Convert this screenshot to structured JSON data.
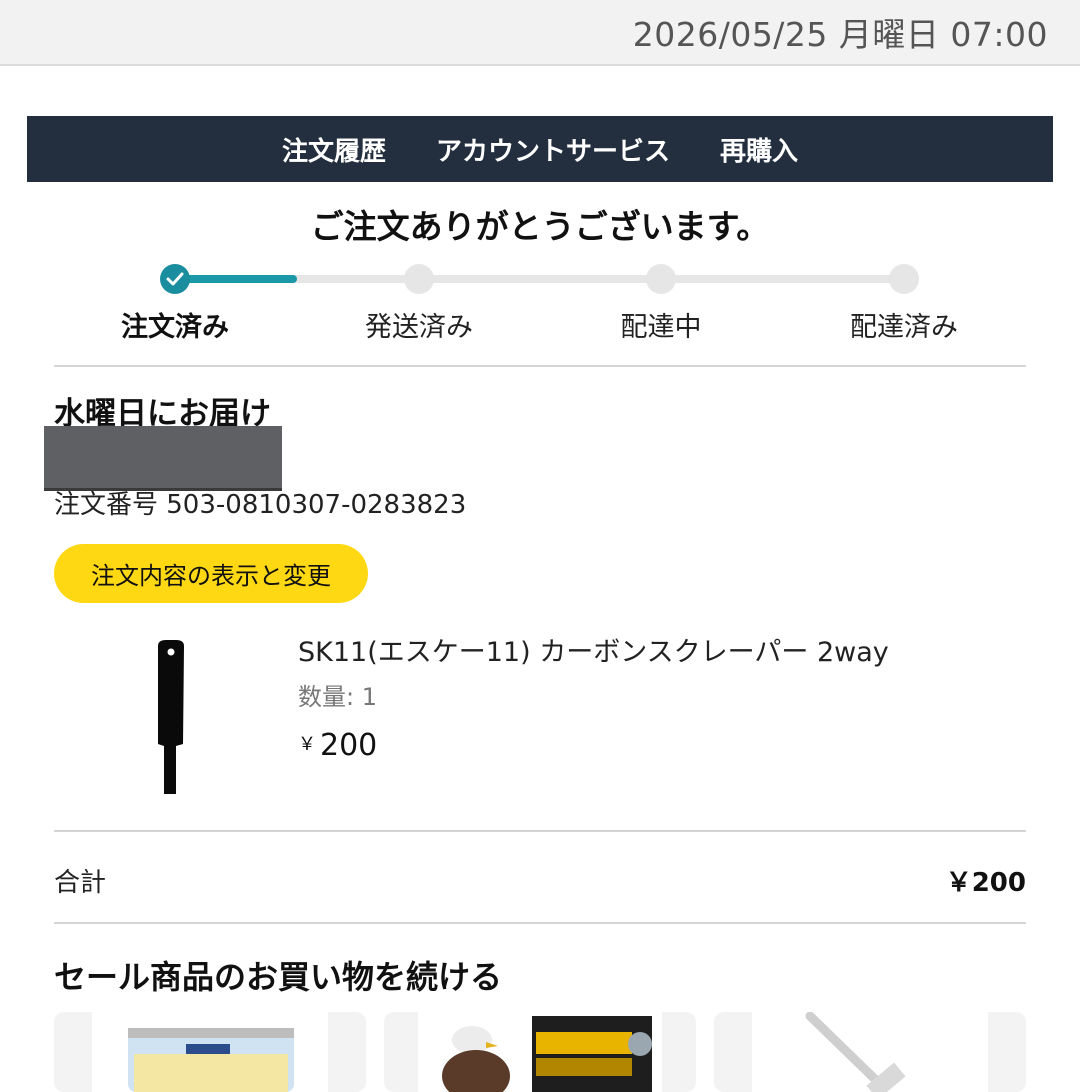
{
  "status_bar": {
    "datetime": "2026/05/25 月曜日 07:00"
  },
  "nav": {
    "items": [
      "注文履歴",
      "アカウントサービス",
      "再購入"
    ]
  },
  "confirmation": {
    "title": "ご注文ありがとうございます。"
  },
  "tracking": {
    "steps": [
      "注文済み",
      "発送済み",
      "配達中",
      "配達済み"
    ],
    "current_step": 1
  },
  "order": {
    "delivery_day": "水曜日にお届け",
    "order_number": "注文番号 503-0810307-0283823",
    "view_edit_button": "注文内容の表示と変更"
  },
  "product": {
    "title": "SK11(エスケー11) カーボンスクレーパー 2way",
    "quantity": "数量: 1",
    "currency": "￥",
    "price": "200"
  },
  "summary": {
    "total_label": "合計",
    "total_value": "￥200"
  },
  "sale_section": {
    "heading": "セール商品のお買い物を続ける"
  },
  "colors": {
    "nav_bg": "#232f3e",
    "accent": "#1a98a8",
    "button_yellow": "#ffd814"
  }
}
